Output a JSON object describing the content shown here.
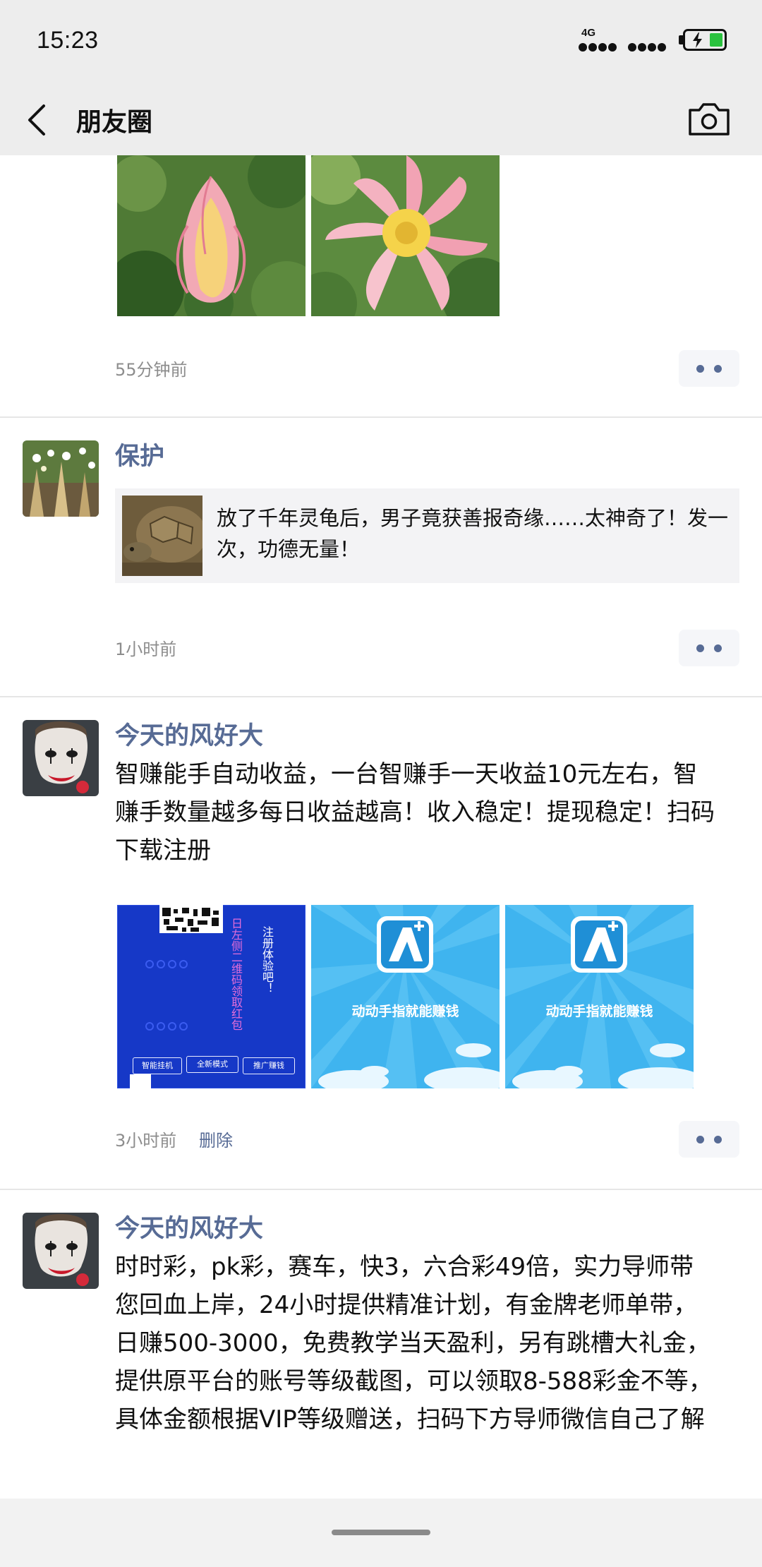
{
  "status_bar": {
    "time": "15:23",
    "network_type": "4G",
    "battery_state": "charging",
    "battery_color": "#2ac23e"
  },
  "header": {
    "title": "朋友圈",
    "back_icon": "chevron-left-icon",
    "camera_icon": "camera-icon"
  },
  "theme": {
    "nickname_color": "#576b95",
    "header_bg": "#ededed"
  },
  "posts": [
    {
      "images": [
        "pink-lotus-bud",
        "pink-lotus-flower"
      ],
      "time": "55分钟前"
    },
    {
      "nickname": "保护",
      "avatar": "grass-flowers-avatar",
      "link_card": {
        "title": "放了千年灵龟后，男子竟获善报奇缘……太神奇了！发一次，功德无量！",
        "thumbnail": "tortoise-image"
      },
      "time": "1小时前"
    },
    {
      "nickname": "今天的风好大",
      "avatar": "clown-face-avatar",
      "text": "智赚能手自动收益，一台智赚手一天收益10元左右，智赚手数量越多每日收益越高！收入稳定！提现稳定！扫码下载注册",
      "images": [
        {
          "kind": "qr-poster",
          "vertical_text_1": "日左侧二维码领取红包",
          "vertical_text_2": "注册体验吧！",
          "buttons": [
            "智能挂机",
            "全新模式",
            "推广赚钱"
          ]
        },
        {
          "kind": "app-poster",
          "caption": "动动手指就能赚钱"
        },
        {
          "kind": "app-poster",
          "caption": "动动手指就能赚钱"
        }
      ],
      "time": "3小时前",
      "delete_label": "删除"
    },
    {
      "nickname": "今天的风好大",
      "avatar": "clown-face-avatar",
      "text": "时时彩，pk彩，赛车，快3，六合彩49倍，实力导师带您回血上岸，24小时提供精准计划，有金牌老师单带，日赚500-3000，免费教学当天盈利，另有跳槽大礼金，提供原平台的账号等级截图，可以领取8-588彩金不等，具体金额根据VIP等级赠送，扫码下方导师微信自己了解"
    }
  ]
}
